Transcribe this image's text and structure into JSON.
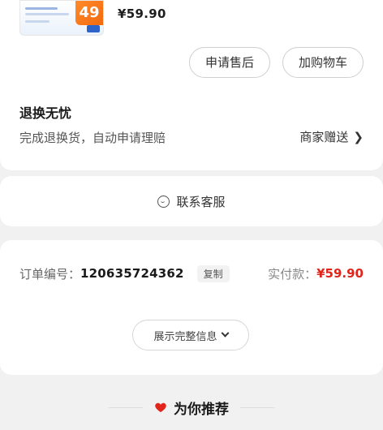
{
  "product": {
    "thumbnail_badge": "49",
    "price": "¥59.90"
  },
  "actions": {
    "after_sales_label": "申请售后",
    "add_cart_label": "加购物车"
  },
  "return_worry_free": {
    "title": "退换无忧",
    "description": "完成退换货，自动申请理赔",
    "link_label": "商家赠送",
    "link_chevron": "❯"
  },
  "customer_service": {
    "label": "联系客服",
    "icon": "smile-chat-icon"
  },
  "order": {
    "number_label": "订单编号：",
    "number_value": "120635724362",
    "copy_label": "复制",
    "paid_label": "实付款：",
    "paid_value": "¥59.90",
    "expand_label": "展示完整信息"
  },
  "recommend": {
    "title": "为你推荐",
    "icon": "heart-icon"
  },
  "colors": {
    "price_red": "#e1251b",
    "badge_orange": "#f26a0f",
    "page_bg": "#f1f1f1"
  }
}
